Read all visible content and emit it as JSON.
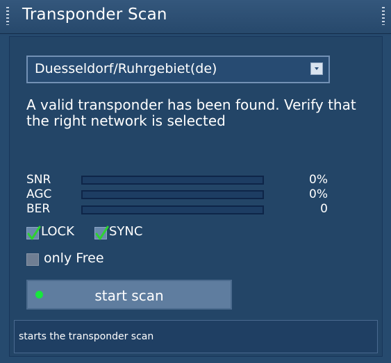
{
  "window": {
    "title": "Transponder Scan"
  },
  "network_select": {
    "value": "Duesseldorf/Ruhrgebiet(de)",
    "icon": "chevron-down-icon"
  },
  "message": "A valid transponder has been found. Verify that the right network is selected",
  "meters": [
    {
      "label": "SNR",
      "value": "0%",
      "level": 0
    },
    {
      "label": "AGC",
      "value": "0%",
      "level": 0
    },
    {
      "label": "BER",
      "value": "0",
      "level": 0
    }
  ],
  "status_flags": {
    "lock": {
      "label": "LOCK",
      "checked": true
    },
    "sync": {
      "label": "SYNC",
      "checked": true
    }
  },
  "only_free": {
    "label": "only Free",
    "checked": false
  },
  "scan_button": {
    "label": "start scan",
    "indicator_color": "#16e83c"
  },
  "status_bar": "starts the transponder scan",
  "colors": {
    "background": "#264a6e",
    "panel": "#234567",
    "button": "#5f7d9f",
    "check_green": "#2dd230"
  }
}
